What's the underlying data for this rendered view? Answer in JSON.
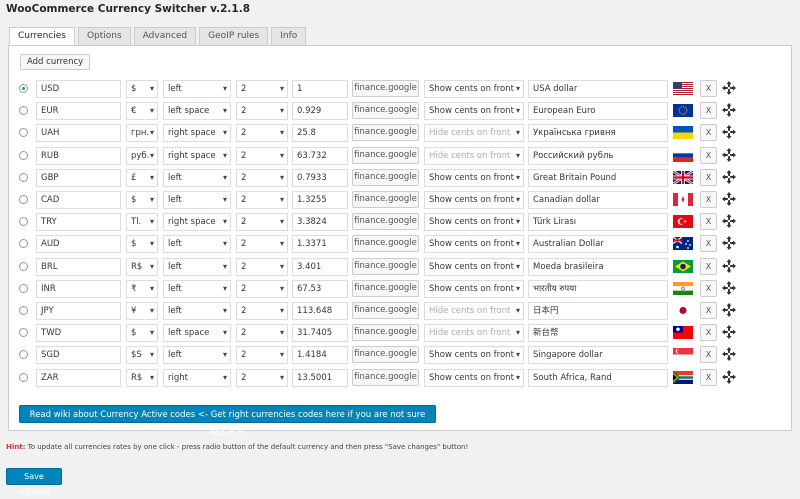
{
  "title": "WooCommerce Currency Switcher v.2.1.8",
  "tabs": [
    "Currencies",
    "Options",
    "Advanced",
    "GeoIP rules",
    "Info"
  ],
  "add_currency_label": "Add currency",
  "finance_label": "finance.google",
  "remove_label": "X",
  "currencies": [
    {
      "code": "USD",
      "symbol": "$",
      "position": "left",
      "decimals": "2",
      "rate": "1",
      "cents": "Show cents on front",
      "cents_enabled": true,
      "description": "USA dollar",
      "flag": "us",
      "checked": true
    },
    {
      "code": "EUR",
      "symbol": "€",
      "position": "left space",
      "decimals": "2",
      "rate": "0.929",
      "cents": "Show cents on front",
      "cents_enabled": true,
      "description": "European Euro",
      "flag": "eu",
      "checked": false
    },
    {
      "code": "UAH",
      "symbol": "грн.",
      "position": "right space",
      "decimals": "2",
      "rate": "25.8",
      "cents": "Hide cents on front",
      "cents_enabled": false,
      "description": "Українська гривня",
      "flag": "ua",
      "checked": false
    },
    {
      "code": "RUB",
      "symbol": "руб.",
      "position": "right space",
      "decimals": "2",
      "rate": "63.732",
      "cents": "Hide cents on front",
      "cents_enabled": false,
      "description": "Российский рубль",
      "flag": "ru",
      "checked": false
    },
    {
      "code": "GBP",
      "symbol": "£",
      "position": "left",
      "decimals": "2",
      "rate": "0.7933",
      "cents": "Show cents on front",
      "cents_enabled": true,
      "description": "Great Britain Pound",
      "flag": "gb",
      "checked": false
    },
    {
      "code": "CAD",
      "symbol": "$",
      "position": "left",
      "decimals": "2",
      "rate": "1.3255",
      "cents": "Show cents on front",
      "cents_enabled": true,
      "description": "Canadian dollar",
      "flag": "ca",
      "checked": false
    },
    {
      "code": "TRY",
      "symbol": "Tl.",
      "position": "right space",
      "decimals": "2",
      "rate": "3.3824",
      "cents": "Show cents on front",
      "cents_enabled": true,
      "description": "Türk Lirası",
      "flag": "tr",
      "checked": false
    },
    {
      "code": "AUD",
      "symbol": "$",
      "position": "left",
      "decimals": "2",
      "rate": "1.3371",
      "cents": "Show cents on front",
      "cents_enabled": true,
      "description": "Australian Dollar",
      "flag": "au",
      "checked": false
    },
    {
      "code": "BRL",
      "symbol": "R$",
      "position": "left",
      "decimals": "2",
      "rate": "3.401",
      "cents": "Show cents on front",
      "cents_enabled": true,
      "description": "Moeda brasileira",
      "flag": "br",
      "checked": false
    },
    {
      "code": "INR",
      "symbol": "₹",
      "position": "left",
      "decimals": "2",
      "rate": "67.53",
      "cents": "Show cents on front",
      "cents_enabled": true,
      "description": "भारतीय रुपया",
      "flag": "in",
      "checked": false
    },
    {
      "code": "JPY",
      "symbol": "¥",
      "position": "left",
      "decimals": "2",
      "rate": "113.648",
      "cents": "Hide cents on front",
      "cents_enabled": false,
      "description": "日本円",
      "flag": "jp",
      "checked": false
    },
    {
      "code": "TWD",
      "symbol": "$",
      "position": "left space",
      "decimals": "2",
      "rate": "31.7405",
      "cents": "Hide cents on front",
      "cents_enabled": false,
      "description": "新台幣",
      "flag": "tw",
      "checked": false
    },
    {
      "code": "SGD",
      "symbol": "$S",
      "position": "left",
      "decimals": "2",
      "rate": "1.4184",
      "cents": "Show cents on front",
      "cents_enabled": true,
      "description": "Singapore dollar",
      "flag": "sg",
      "checked": false
    },
    {
      "code": "ZAR",
      "symbol": "R$",
      "position": "right",
      "decimals": "2",
      "rate": "13.5001",
      "cents": "Show cents on front",
      "cents_enabled": true,
      "description": "South Africa, Rand",
      "flag": "za",
      "checked": false
    }
  ],
  "wiki_button": "Read wiki about Currency Active codes  <- Get right currencies codes here if you are not sure about it!",
  "hint_label": "Hint:",
  "hint_text": " To update all currencies rates by one click - press radio button of the default currency and then press \"Save changes\" button!",
  "save_label": "Save changes",
  "colors": {
    "primary": "#0085ba",
    "hint": "#dc3232"
  }
}
